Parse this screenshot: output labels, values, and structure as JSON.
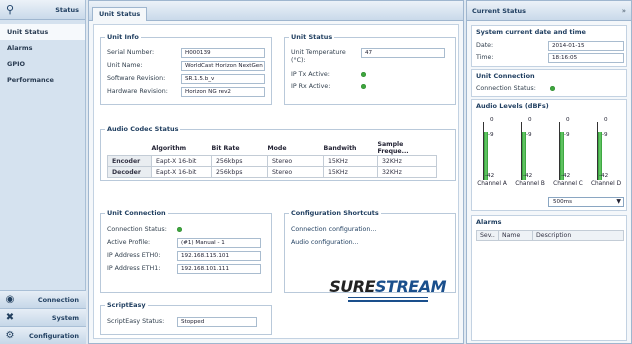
{
  "sidebar": {
    "header": {
      "title": "Status",
      "icon": "search-icon"
    },
    "nav": [
      {
        "label": "Unit Status",
        "active": true
      },
      {
        "label": "Alarms"
      },
      {
        "label": "GPIO"
      },
      {
        "label": "Performance"
      }
    ],
    "bottom": [
      {
        "label": "Connection",
        "icon": "connection-icon"
      },
      {
        "label": "System",
        "icon": "tools-icon"
      },
      {
        "label": "Configuration",
        "icon": "gear-icon"
      }
    ]
  },
  "main": {
    "tab": "Unit Status",
    "unit_info": {
      "legend": "Unit Info",
      "serial_label": "Serial Number:",
      "serial_value": "H000139",
      "name_label": "Unit Name:",
      "name_value": "WorldCast Horizon NextGen",
      "sw_label": "Software Revision:",
      "sw_value": "SR.1.5.b_v",
      "hw_label": "Hardware Revision:",
      "hw_value": "Horizon NG rev2"
    },
    "unit_status": {
      "legend": "Unit Status",
      "temp_label": "Unit Temperature (°C):",
      "temp_value": "47",
      "tx_label": "IP Tx Active:",
      "rx_label": "IP Rx Active:"
    },
    "codec": {
      "legend": "Audio Codec Status",
      "headers": [
        "",
        "Algorithm",
        "Bit Rate",
        "Mode",
        "Bandwith",
        "Sample Freque..."
      ],
      "rows": [
        [
          "Encoder",
          "Eapt-X 16-bit",
          "256kbps",
          "Stereo",
          "15KHz",
          "32KHz"
        ],
        [
          "Decoder",
          "Eapt-X 16-bit",
          "256kbps",
          "Stereo",
          "15KHz",
          "32KHz"
        ]
      ]
    },
    "unit_connection": {
      "legend": "Unit Connection",
      "status_label": "Connection Status:",
      "profile_label": "Active Profile:",
      "profile_value": "(#1) Manual - 1",
      "eth0_label": "IP Address ETH0:",
      "eth0_value": "192.168.115.101",
      "eth1_label": "IP Address ETH1:",
      "eth1_value": "192.168.101.111"
    },
    "shortcuts": {
      "legend": "Configuration Shortcuts",
      "links": [
        "Connection configuration...",
        "Audio configuration..."
      ]
    },
    "scripteasy": {
      "legend": "ScriptEasy",
      "status_label": "ScriptEasy Status:",
      "status_value": "Stopped"
    },
    "logo": {
      "part1": "SURE",
      "part2": "STREAM"
    }
  },
  "right": {
    "title": "Current Status",
    "close": "»",
    "datetime": {
      "legend": "System current date and time",
      "date_label": "Date:",
      "date_value": "2014-01-15",
      "time_label": "Time:",
      "time_value": "18:16:05"
    },
    "connection": {
      "legend": "Unit Connection",
      "status_label": "Connection Status:"
    },
    "audio": {
      "legend": "Audio Levels (dBFs)",
      "top_label": "0",
      "peak_label": "-9",
      "bottom_label": "-42",
      "channels": [
        {
          "name": "Channel A",
          "level_fraction": 0.82
        },
        {
          "name": "Channel B",
          "level_fraction": 0.82
        },
        {
          "name": "Channel C",
          "level_fraction": 0.82
        },
        {
          "name": "Channel D",
          "level_fraction": 0.82
        }
      ],
      "interval": "500ms"
    },
    "alarms": {
      "legend": "Alarms",
      "headers": [
        "Sev..",
        "Name",
        "Description"
      ]
    }
  },
  "colors": {
    "status_green": "#3ea63e",
    "accent": "#1e3d5f",
    "brand_blue": "#1a4f8c"
  }
}
